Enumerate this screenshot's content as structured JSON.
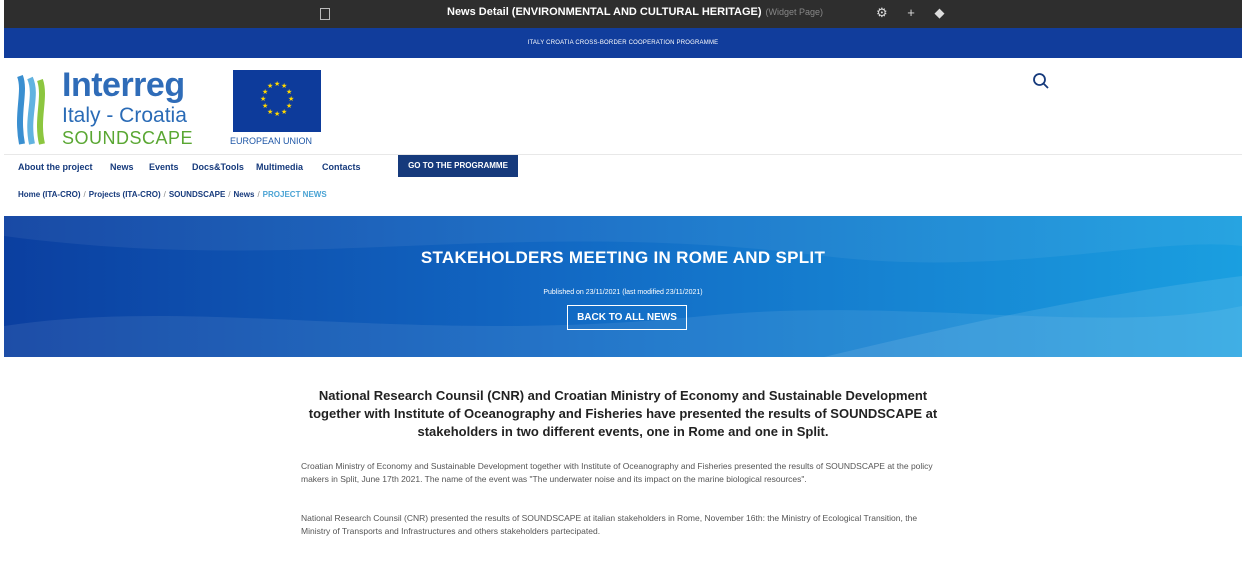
{
  "admin_bar": {
    "title": "News Detail (ENVIRONMENTAL AND CULTURAL HERITAGE)",
    "subtitle": "(Widget Page)",
    "tools": "⚙ + ◆"
  },
  "programme_bar": {
    "text": "ITALY CROATIA CROSS-BORDER COOPERATION PROGRAMME"
  },
  "logo": {
    "interreg": "Interreg",
    "italy_croatia": "Italy - Croatia",
    "project": "SOUNDSCAPE",
    "eu_label": "EUROPEAN UNION"
  },
  "colors": {
    "navy": "#163a7c",
    "programme_blue": "#113d9c",
    "hero_left": "#0b3fa0",
    "hero_right": "#1a9fe0",
    "breadcrumb_current": "#4aa3d4",
    "logo_green": "#5aa733"
  },
  "nav": {
    "items": [
      {
        "label": "About the project"
      },
      {
        "label": "News"
      },
      {
        "label": "Events"
      },
      {
        "label": "Docs&Tools"
      },
      {
        "label": "Multimedia"
      },
      {
        "label": "Contacts"
      }
    ],
    "cta": "GO TO THE PROGRAMME"
  },
  "breadcrumb": {
    "items": [
      "Home (ITA-CRO)",
      "Projects (ITA-CRO)",
      "SOUNDSCAPE",
      "News"
    ],
    "current": "PROJECT NEWS"
  },
  "hero": {
    "title": "STAKEHOLDERS MEETING IN ROME AND SPLIT",
    "published": "Published on 23/11/2021 (last modified 23/11/2021)",
    "back_label": "BACK TO ALL NEWS"
  },
  "article": {
    "heading": "National Research Counsil (CNR) and Croatian Ministry of Economy and Sustainable Development together with Institute of Oceanography and Fisheries have presented the results of SOUNDSCAPE at stakeholders in two different events, one in Rome and one in Split.",
    "paragraph1": "Croatian Ministry of Economy and Sustainable Development together with Institute of Oceanography and Fisheries presented the results of SOUNDSCAPE at the policy makers in Split, June 17th 2021. The name of the event was \"The underwater noise and its impact on the marine biological resources\".",
    "paragraph2": "National Research Counsil (CNR) presented the results of SOUNDSCAPE at italian stakeholders in Rome, November 16th: the Ministry of Ecological Transition, the Ministry of Transports and Infrastructures and others stakeholders partecipated."
  },
  "icons": {
    "search": "search-icon",
    "page": "page-icon",
    "eu_flag": "eu-flag-icon"
  }
}
